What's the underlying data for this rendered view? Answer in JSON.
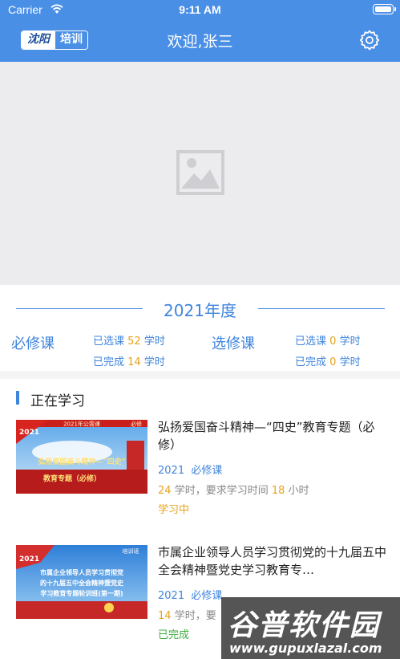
{
  "status_bar": {
    "carrier": "Carrier",
    "time": "9:11 AM"
  },
  "header": {
    "logo_left": "沈阳",
    "logo_right": "培训",
    "title": "欢迎,张三",
    "settings_icon": "gear-icon"
  },
  "banner": {
    "placeholder_icon": "image-placeholder-icon"
  },
  "summary": {
    "year_label": "2021年度",
    "required": {
      "label": "必修课",
      "selected_prefix": "已选课",
      "selected_value": "52",
      "completed_prefix": "已完成",
      "completed_value": "14",
      "unit": "学时"
    },
    "elective": {
      "label": "选修课",
      "selected_prefix": "已选课",
      "selected_value": "0",
      "completed_prefix": "已完成",
      "completed_value": "0",
      "unit": "学时"
    }
  },
  "section": {
    "title": "正在学习"
  },
  "courses": [
    {
      "title": "弘扬爱国奋斗精神—“四史”教育专题（必修）",
      "year": "2021",
      "category": "必修课",
      "hours": "24",
      "hours_text": "学时，要求学习时间",
      "required_time": "18",
      "time_unit": "小时",
      "status": "学习中",
      "thumb_text": {
        "top": "2021年公需课",
        "badge": "必修",
        "year": "2021",
        "line1": "弘扬爱国奋斗精神—“四史”",
        "line2": "教育专题（必修）"
      }
    },
    {
      "title": "市属企业领导人员学习贯彻党的十九届五中全会精神暨党史学习教育专…",
      "year": "2021",
      "category": "必修课",
      "hours": "14",
      "hours_text": "学时，要",
      "status": "已完成",
      "thumb_text": {
        "badge": "培训班",
        "year": "2021",
        "line1": "市属企业领导人员学习贯彻党",
        "line2": "的十九届五中全会精神暨党史",
        "line3": "学习教育专题轮训班(第一期)"
      }
    }
  ],
  "watermark": {
    "text": "谷普软件园",
    "url": "www.gupuxlazal.com"
  }
}
